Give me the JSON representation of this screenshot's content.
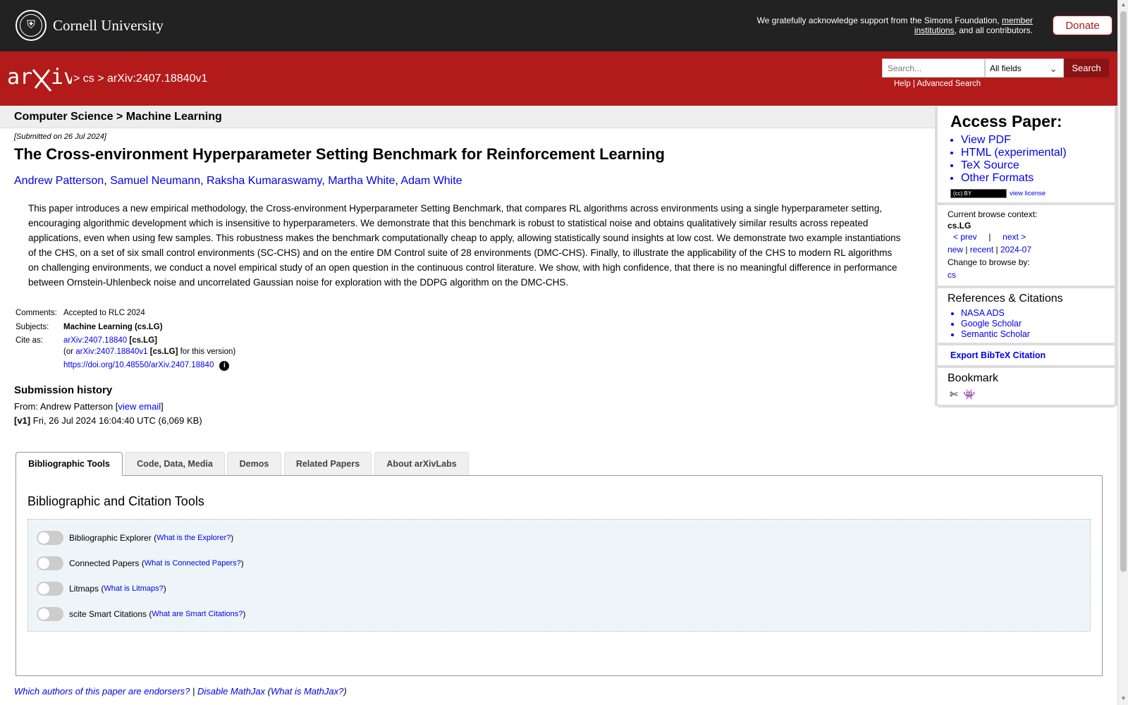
{
  "banner": {
    "institution": "Cornell University",
    "support_pre": "We gratefully acknowledge support from the Simons Foundation,",
    "support_link": "member institutions",
    "support_post": ", and all contributors.",
    "donate_label": "Donate"
  },
  "header": {
    "logo_text": "arXiv",
    "breadcrumb_cs": "cs",
    "breadcrumb_id": "arXiv:2407.18840v1",
    "search_placeholder": "Search...",
    "search_field": "All fields",
    "search_button": "Search",
    "help_link": "Help",
    "advanced_link": "Advanced Search"
  },
  "subject_bar": "Computer Science > Machine Learning",
  "paper": {
    "submitted": "[Submitted on 26 Jul 2024]",
    "title": "The Cross-environment Hyperparameter Setting Benchmark for Reinforcement Learning",
    "authors": [
      "Andrew Patterson",
      "Samuel Neumann",
      "Raksha Kumaraswamy",
      "Martha White",
      "Adam White"
    ],
    "abstract": "This paper introduces a new empirical methodology, the Cross-environment Hyperparameter Setting Benchmark, that compares RL algorithms across environments using a single hyperparameter setting, encouraging algorithmic development which is insensitive to hyperparameters. We demonstrate that this benchmark is robust to statistical noise and obtains qualitatively similar results across repeated applications, even when using few samples. This robustness makes the benchmark computationally cheap to apply, allowing statistically sound insights at low cost. We demonstrate two example instantiations of the CHS, on a set of six small control environments (SC-CHS) and on the entire DM Control suite of 28 environments (DMC-CHS). Finally, to illustrate the applicability of the CHS to modern RL algorithms on challenging environments, we conduct a novel empirical study of an open question in the continuous control literature. We show, with high confidence, that there is no meaningful difference in performance between Ornstein-Uhlenbeck noise and uncorrelated Gaussian noise for exploration with the DDPG algorithm on the DMC-CHS.",
    "comments_label": "Comments:",
    "comments": "Accepted to RLC 2024",
    "subjects_label": "Subjects:",
    "subjects": "Machine Learning (cs.LG)",
    "cite_label": "Cite as:",
    "cite_id": "arXiv:2407.18840",
    "cite_tag": "[cs.LG]",
    "cite_or_pre": "(or",
    "cite_v_id": "arXiv:2407.18840v1",
    "cite_v_tag": "[cs.LG]",
    "cite_or_post": "for this version)",
    "doi": "https://doi.org/10.48550/arXiv.2407.18840",
    "history_title": "Submission history",
    "from_pre": "From: Andrew Patterson [",
    "view_email": "view email",
    "from_post": "]",
    "v1_label": "[v1]",
    "v1_text": "Fri, 26 Jul 2024 16:04:40 UTC (6,069 KB)"
  },
  "tabs": [
    {
      "label": "Bibliographic Tools"
    },
    {
      "label": "Code, Data, Media"
    },
    {
      "label": "Demos"
    },
    {
      "label": "Related Papers"
    },
    {
      "label": "About arXivLabs"
    }
  ],
  "panel": {
    "title": "Bibliographic and Citation Tools",
    "tools": [
      {
        "name": "Bibliographic Explorer",
        "link": "What is the Explorer?"
      },
      {
        "name": "Connected Papers",
        "link": "What is Connected Papers?"
      },
      {
        "name": "Litmaps",
        "link": "What is Litmaps?"
      },
      {
        "name": "scite Smart Citations",
        "link": "What are Smart Citations?"
      }
    ]
  },
  "footer": {
    "endorsers": "Which authors of this paper are endorsers?",
    "sep": "|",
    "disable_mathjax": "Disable MathJax",
    "what_mathjax": "What is MathJax?"
  },
  "sidebar": {
    "access_title": "Access Paper:",
    "access_links": [
      "View PDF",
      "HTML (experimental)",
      "TeX Source",
      "Other Formats"
    ],
    "cc_badge": "(cc) BY",
    "view_license": "view license",
    "context_label": "Current browse context:",
    "context_value": "cs.LG",
    "prev": "< prev",
    "sep": "|",
    "next": "next >",
    "new": "new",
    "recent": "recent",
    "month": "2024-07",
    "change_label": "Change to browse by:",
    "change_value": "cs",
    "refs_title": "References & Citations",
    "refs_links": [
      "NASA ADS",
      "Google Scholar",
      "Semantic Scholar"
    ],
    "export_bibtex": "Export BibTeX Citation",
    "bookmark_title": "Bookmark"
  }
}
